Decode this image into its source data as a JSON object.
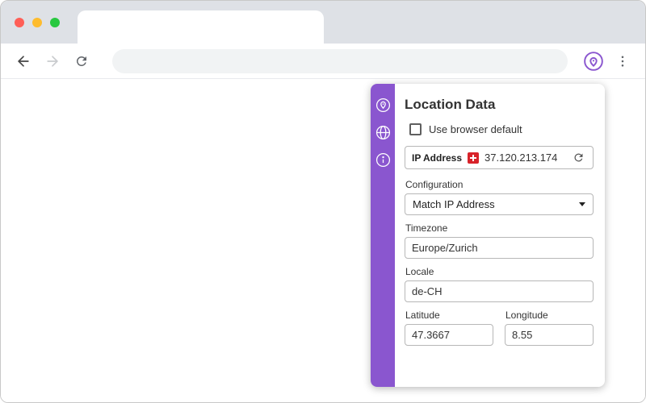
{
  "browser": {
    "tab_title": "",
    "address_value": "",
    "icons": {
      "back": "back-arrow",
      "forward": "forward-arrow",
      "reload": "reload-arrow",
      "extension": "vytal-location-extension",
      "menu": "kebab-menu"
    }
  },
  "panel": {
    "title": "Location Data",
    "accent_color": "#8a56cf",
    "sidebar_icons": [
      "location-pin",
      "globe",
      "info"
    ],
    "browser_default": {
      "label": "Use browser default",
      "checked": false
    },
    "ip": {
      "label": "IP Address",
      "country_flag": "CH",
      "value": "37.120.213.174"
    },
    "configuration": {
      "label": "Configuration",
      "value": "Match IP Address"
    },
    "timezone": {
      "label": "Timezone",
      "value": "Europe/Zurich"
    },
    "locale": {
      "label": "Locale",
      "value": "de-CH"
    },
    "latitude": {
      "label": "Latitude",
      "value": "47.3667"
    },
    "longitude": {
      "label": "Longitude",
      "value": "8.55"
    }
  }
}
